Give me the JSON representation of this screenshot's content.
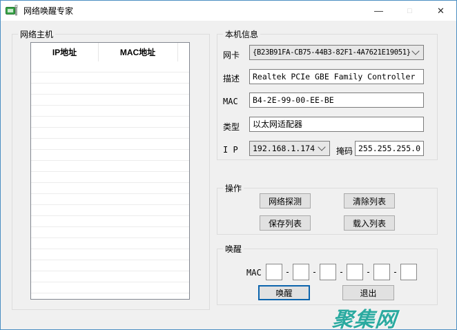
{
  "window": {
    "title": "网络唤醒专家",
    "controls": {
      "minimize": "—",
      "maximize": "□",
      "close": "✕"
    }
  },
  "host_list": {
    "label": "网络主机",
    "columns": [
      "IP地址",
      "MAC地址"
    ],
    "rows": []
  },
  "local_info": {
    "label": "本机信息",
    "adapter": {
      "label": "网卡",
      "value": "{B23B91FA-CB75-44B3-82F1-4A7621E19051}"
    },
    "description": {
      "label": "描述",
      "value": "Realtek PCIe GBE Family Controller"
    },
    "mac": {
      "label": "MAC",
      "value": "B4-2E-99-00-EE-BE"
    },
    "type": {
      "label": "类型",
      "value": "以太网适配器"
    },
    "ip": {
      "label": "I P",
      "value": "192.168.1.174"
    },
    "mask": {
      "label": "掩码",
      "value": "255.255.255.0"
    }
  },
  "actions": {
    "label": "操作",
    "buttons": [
      "网络探测",
      "清除列表",
      "保存列表",
      "载入列表"
    ]
  },
  "wake": {
    "label": "唤醒",
    "mac_label": "MAC",
    "separator": "-",
    "octets": [
      "",
      "",
      "",
      "",
      "",
      ""
    ],
    "wake_button": "唤醒",
    "exit_button": "退出"
  },
  "watermark": {
    "text": "聚集网",
    "color": "#2baaa0"
  }
}
